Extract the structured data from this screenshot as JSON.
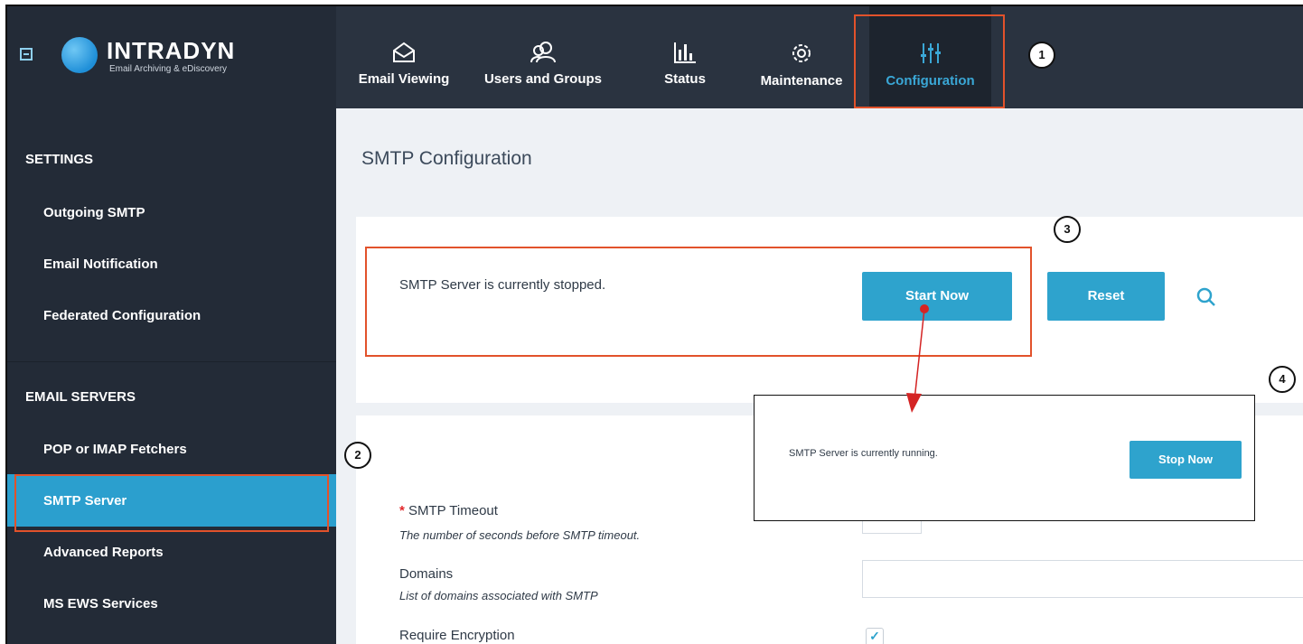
{
  "header": {
    "brand_name": "INTRADYN",
    "brand_tagline": "Email Archiving & eDiscovery",
    "nav": [
      {
        "label": "Email Viewing",
        "icon": "envelope-icon"
      },
      {
        "label": "Users and Groups",
        "icon": "users-icon"
      },
      {
        "label": "Status",
        "icon": "bar-chart-icon"
      },
      {
        "label": "Maintenance",
        "icon": "gear-icon"
      },
      {
        "label": "Configuration",
        "icon": "sliders-icon",
        "active": true
      }
    ]
  },
  "callouts": [
    "1",
    "2",
    "3",
    "4"
  ],
  "sidebar": {
    "settings_heading": "SETTINGS",
    "settings_items": [
      "Outgoing SMTP",
      "Email Notification",
      "Federated Configuration"
    ],
    "servers_heading": "EMAIL SERVERS",
    "server_items": [
      "POP or IMAP Fetchers",
      "SMTP Server",
      "Advanced Reports",
      "MS EWS Services"
    ],
    "active_item": "SMTP Server"
  },
  "main": {
    "title": "SMTP Configuration",
    "status_text": "SMTP Server is currently stopped.",
    "start_button": "Start Now",
    "reset_button": "Reset",
    "form": {
      "timeout_label": "SMTP Timeout",
      "timeout_help": "The number of seconds before SMTP timeout.",
      "domains_label": "Domains",
      "domains_help": "List of domains associated with SMTP",
      "encryption_label": "Require Encryption",
      "encryption_checked": true,
      "required_marker": "*"
    }
  },
  "popup": {
    "status_text": "SMTP Server is currently running.",
    "stop_button": "Stop Now"
  },
  "colors": {
    "header_bg": "#232b37",
    "accent": "#2ea3cd",
    "callout_red": "#e2522b"
  }
}
